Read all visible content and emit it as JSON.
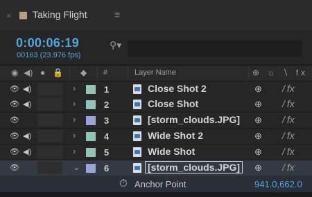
{
  "tab": {
    "close_glyph": "×",
    "title": "Taking Flight",
    "menu_glyph": "≡",
    "swatch_color": "#b9a07c"
  },
  "timecode": {
    "current": "0:00:06:19",
    "frames": "00163 (23.976 fps)"
  },
  "search": {
    "icon": "search-icon",
    "value": "",
    "placeholder": ""
  },
  "header": {
    "eye": "◉",
    "audio": "◀)",
    "solo": "●",
    "lock": "🔒",
    "label_icon": "◆",
    "num": "#",
    "layer_name": "Layer Name",
    "switches": "⊕ ☼ ∖ fx"
  },
  "layers": [
    {
      "num": "1",
      "name": "Close Shot 2",
      "label_color": "#8fc4b6",
      "audio": true,
      "expanded": false,
      "type": "video"
    },
    {
      "num": "2",
      "name": "Close Shot",
      "label_color": "#8fc4b6",
      "audio": true,
      "expanded": false,
      "type": "video"
    },
    {
      "num": "3",
      "name": "[storm_clouds.JPG]",
      "label_color": "#9aa3d6",
      "audio": false,
      "expanded": false,
      "type": "image"
    },
    {
      "num": "4",
      "name": "Wide Shot 2",
      "label_color": "#8fc4b6",
      "audio": true,
      "expanded": false,
      "type": "video"
    },
    {
      "num": "5",
      "name": "Wide Shot",
      "label_color": "#8fc4b6",
      "audio": true,
      "expanded": false,
      "type": "video"
    },
    {
      "num": "6",
      "name": "[storm_clouds.JPG]",
      "label_color": "#9aa3d6",
      "audio": false,
      "expanded": true,
      "type": "image"
    }
  ],
  "glyphs": {
    "eye": "👁",
    "audio": "◀)",
    "chevron_right": "›",
    "chevron_down": "⌄",
    "switch_a": "⊕",
    "switch_slash": "/",
    "switch_fx": "fx"
  },
  "property": {
    "icon": "stopwatch-icon",
    "label": "Anchor Point",
    "value": "941.0,662.0"
  }
}
